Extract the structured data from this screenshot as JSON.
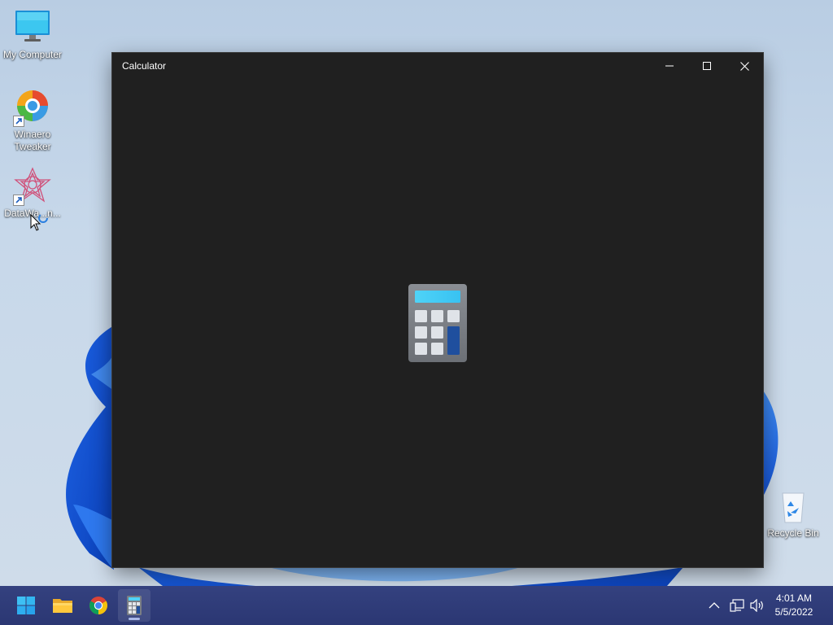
{
  "desktop": {
    "icons": [
      {
        "label": "My Computer",
        "icon": "monitor-icon"
      },
      {
        "label": "Winaero Tweaker",
        "icon": "winaero-tweaker-icon"
      },
      {
        "label": "DataWa...n...",
        "icon": "datawarrior-icon"
      },
      {
        "label": "Recycle Bin",
        "icon": "recycle-bin-icon"
      }
    ]
  },
  "window": {
    "title": "Calculator",
    "controls": [
      "minimize-icon",
      "maximize-icon",
      "close-icon"
    ],
    "splash_icon": "calculator-icon",
    "background": "#202020"
  },
  "taskbar": {
    "background": "#2d3a78",
    "pinned": [
      {
        "name": "start",
        "icon": "windows-logo-icon"
      },
      {
        "name": "file-explorer",
        "icon": "folder-icon"
      },
      {
        "name": "chrome",
        "icon": "chrome-icon"
      },
      {
        "name": "calculator",
        "icon": "calculator-icon",
        "active": true
      }
    ],
    "tray": [
      "chevron-up-icon",
      "network-icon",
      "volume-icon"
    ],
    "clock": {
      "time": "4:01 AM",
      "date": "5/5/2022"
    }
  }
}
